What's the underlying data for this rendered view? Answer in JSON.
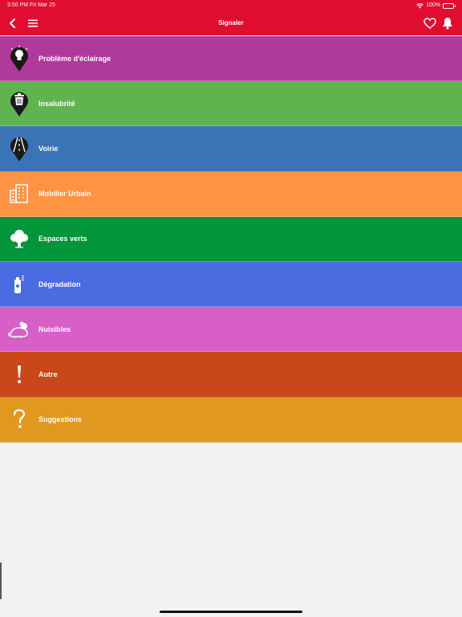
{
  "status": {
    "time_date": "3:50 PM  Fri Mar 25",
    "battery": "100%"
  },
  "nav": {
    "title": "Signaler"
  },
  "colors": {
    "header": "#e00d30",
    "background": "#f2f2f2"
  },
  "categories": [
    {
      "label": "Problème d'éclairage",
      "color": "#b03a9c",
      "icon": "lightbulb-pin-icon"
    },
    {
      "label": "Insalubrité",
      "color": "#61b350",
      "icon": "trash-pin-icon"
    },
    {
      "label": "Voirie",
      "color": "#3b74b6",
      "icon": "road-pin-icon"
    },
    {
      "label": "Mobilier Urbain",
      "color": "#ff9344",
      "icon": "building-icon"
    },
    {
      "label": "Espaces verts",
      "color": "#03953a",
      "icon": "tree-icon"
    },
    {
      "label": "Dégradation",
      "color": "#4a6ce0",
      "icon": "spray-can-icon"
    },
    {
      "label": "Nuisibles",
      "color": "#d85ec8",
      "icon": "rat-icon"
    },
    {
      "label": "Autre",
      "color": "#c94719",
      "icon": "exclamation-icon"
    },
    {
      "label": "Suggestions",
      "color": "#e0991e",
      "icon": "question-icon"
    }
  ]
}
